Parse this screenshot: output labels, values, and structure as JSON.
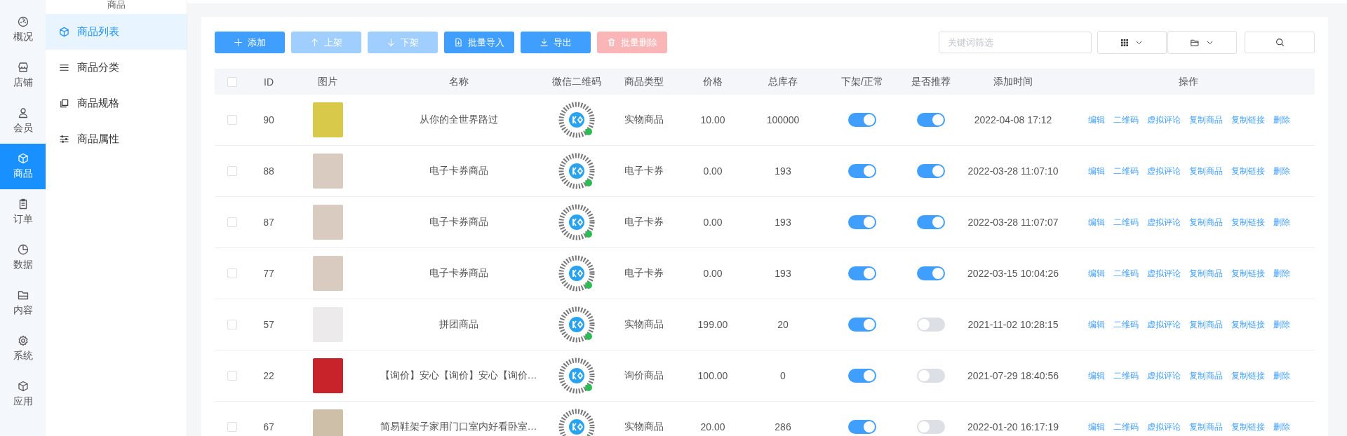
{
  "sidebar": {
    "items": [
      {
        "label": "概况",
        "selected": false
      },
      {
        "label": "店铺",
        "selected": false
      },
      {
        "label": "会员",
        "selected": false
      },
      {
        "label": "商品",
        "selected": true
      },
      {
        "label": "订单",
        "selected": false
      },
      {
        "label": "数据",
        "selected": false
      },
      {
        "label": "内容",
        "selected": false
      },
      {
        "label": "系统",
        "selected": false
      },
      {
        "label": "应用",
        "selected": false
      }
    ]
  },
  "submenu": {
    "title": "商品",
    "items": [
      {
        "label": "商品列表",
        "selected": true
      },
      {
        "label": "商品分类",
        "selected": false
      },
      {
        "label": "商品规格",
        "selected": false
      },
      {
        "label": "商品属性",
        "selected": false
      }
    ]
  },
  "toolbar": {
    "buttons": [
      {
        "label": "添加",
        "kind": "add",
        "disabled": false
      },
      {
        "label": "上架",
        "kind": "up",
        "disabled": true
      },
      {
        "label": "下架",
        "kind": "down",
        "disabled": true
      },
      {
        "label": "批量导入",
        "kind": "import",
        "disabled": false
      },
      {
        "label": "导出",
        "kind": "export",
        "disabled": false
      },
      {
        "label": "批量删除",
        "kind": "delete",
        "disabled": true
      }
    ],
    "search": {
      "placeholder": "关键词筛选"
    }
  },
  "table": {
    "select_all": {
      "checked": false
    },
    "columns": [
      "ID",
      "图片",
      "名称",
      "微信二维码",
      "商品类型",
      "价格",
      "总库存",
      "下架/正常",
      "是否推荐",
      "添加时间",
      "操作"
    ],
    "rows": [
      {
        "checked": false,
        "id": "90",
        "name": "从你的全世界路过",
        "type": "实物商品",
        "price": "10.00",
        "stock": "100000",
        "on_sale": true,
        "recommended": true,
        "added": "2022-04-08 17:12",
        "actions": [
          "编辑",
          "二维码",
          "虚拟评论",
          "复制商品",
          "复制链接",
          "删除"
        ]
      },
      {
        "checked": false,
        "id": "88",
        "name": "电子卡券商品",
        "type": "电子卡券",
        "price": "0.00",
        "stock": "193",
        "on_sale": true,
        "recommended": true,
        "added": "2022-03-28 11:07:10",
        "actions": [
          "编辑",
          "二维码",
          "虚拟评论",
          "复制商品",
          "复制链接",
          "删除"
        ]
      },
      {
        "checked": false,
        "id": "87",
        "name": "电子卡券商品",
        "type": "电子卡券",
        "price": "0.00",
        "stock": "193",
        "on_sale": true,
        "recommended": true,
        "added": "2022-03-28 11:07:07",
        "actions": [
          "编辑",
          "二维码",
          "虚拟评论",
          "复制商品",
          "复制链接",
          "删除"
        ]
      },
      {
        "checked": false,
        "id": "77",
        "name": "电子卡券商品",
        "type": "电子卡券",
        "price": "0.00",
        "stock": "193",
        "on_sale": true,
        "recommended": true,
        "added": "2022-03-15 10:04:26",
        "actions": [
          "编辑",
          "二维码",
          "虚拟评论",
          "复制商品",
          "复制链接",
          "删除"
        ]
      },
      {
        "checked": false,
        "id": "57",
        "name": "拼团商品",
        "type": "实物商品",
        "price": "199.00",
        "stock": "20",
        "on_sale": true,
        "recommended": false,
        "added": "2021-11-02 10:28:15",
        "actions": [
          "编辑",
          "二维码",
          "虚拟评论",
          "复制商品",
          "复制链接",
          "删除"
        ]
      },
      {
        "checked": false,
        "id": "22",
        "name": "【询价】安心【询价】安心【询价…",
        "type": "询价商品",
        "price": "100.00",
        "stock": "0",
        "on_sale": true,
        "recommended": false,
        "added": "2021-07-29 18:40:56",
        "actions": [
          "编辑",
          "二维码",
          "虚拟评论",
          "复制商品",
          "复制链接",
          "删除"
        ]
      },
      {
        "checked": false,
        "id": "67",
        "name": "简易鞋架子家用门口室内好看卧室…",
        "type": "实物商品",
        "price": "20.00",
        "stock": "286",
        "on_sale": true,
        "recommended": false,
        "added": "2022-01-20 16:17:19",
        "actions": [
          "编辑",
          "二维码",
          "虚拟评论",
          "复制商品",
          "复制链接",
          "删除"
        ]
      }
    ]
  }
}
